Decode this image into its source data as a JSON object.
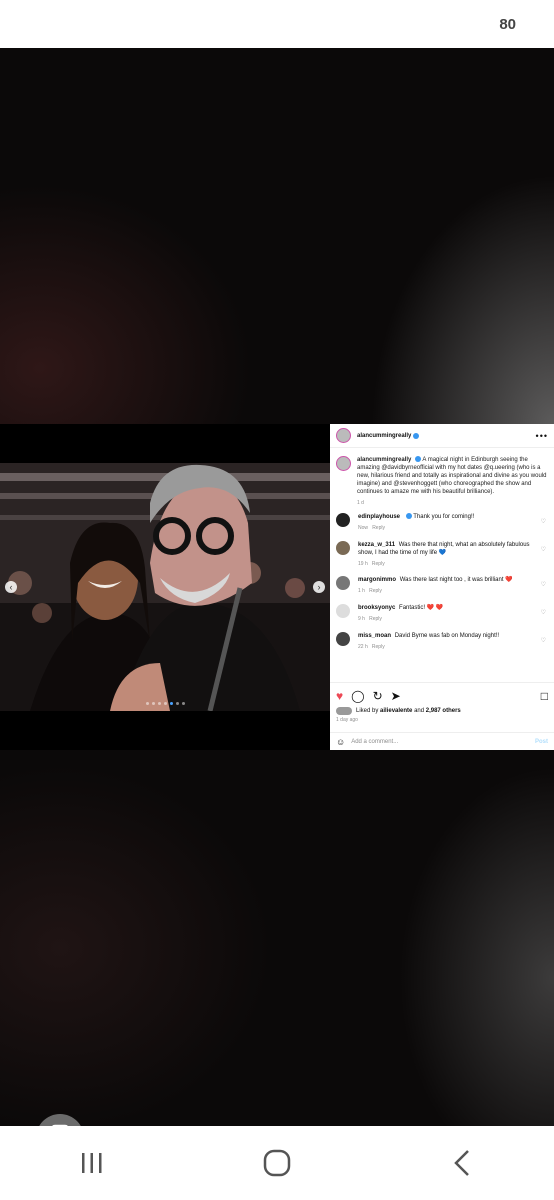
{
  "status_bar": {
    "battery": "80"
  },
  "post": {
    "username": "alancummingreally",
    "caption_prefix": "alancummingreally",
    "caption": "A magical night in Edinburgh seeing the amazing @davidbyrneofficial with my hot dates @q.ueering (who is a new, hilarious friend and totally as inspirational and divine as you would imagine) and @stevenhoggett (who choreographed the show and continues to amaze me with his beautiful brilliance).",
    "caption_time": "1 d",
    "comments": [
      {
        "user": "edinplayhouse",
        "text": "Thank you for coming!!",
        "time": "Now",
        "reply": "Reply"
      },
      {
        "user": "kezza_w_311",
        "text": "Was there that night, what an absolutely fabulous show, I had the time of my life 💙",
        "time": "19 h",
        "reply": "Reply"
      },
      {
        "user": "margonimmo",
        "text": "Was there last night too , it was brilliant ❤️",
        "time": "1 h",
        "reply": "Reply"
      },
      {
        "user": "brooksyonyc",
        "text": "Fantastic! ❤️ ❤️",
        "time": "9 h",
        "reply": "Reply"
      },
      {
        "user": "miss_moan",
        "text": "David Byrne was fab on Monday night!!",
        "time": "22 h",
        "reply": "Reply"
      }
    ],
    "likes_prefix": "Liked by",
    "likes_user": "ailievalente",
    "likes_and": "and",
    "likes_count": "2,987 others",
    "time_ago": "1 day ago",
    "add_comment_placeholder": "Add a comment...",
    "post_button": "Post",
    "carousel_dots": 7,
    "carousel_active": 4
  },
  "colors": {
    "accent_blue": "#3897f0",
    "like_red": "#ed4956"
  },
  "icons": {
    "more": "more-horizontal-icon",
    "like": "heart-icon",
    "comment": "comment-icon",
    "share": "share-icon",
    "save": "bookmark-icon",
    "emoji": "emoji-icon"
  }
}
